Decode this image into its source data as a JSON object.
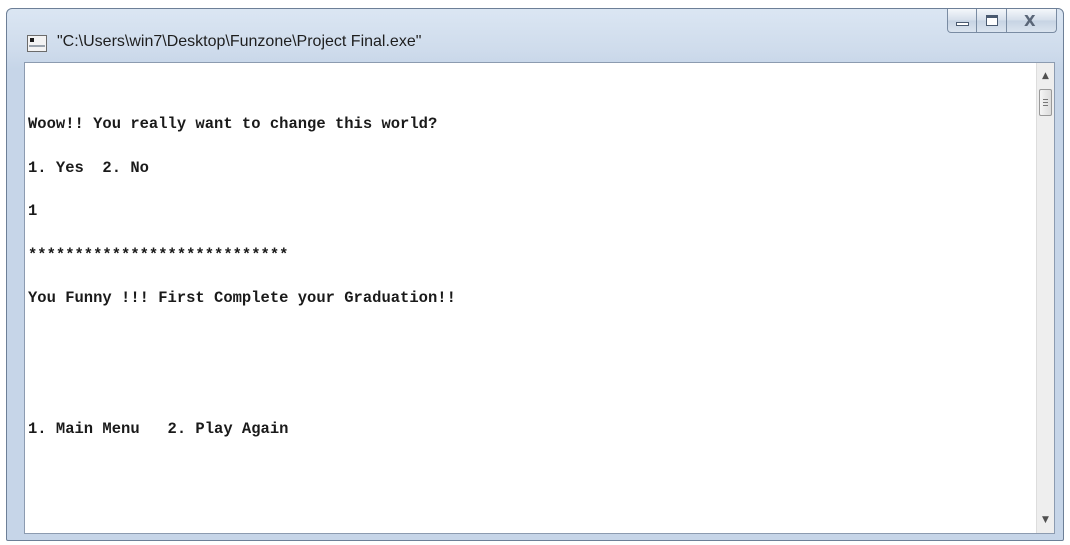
{
  "window": {
    "title": "\"C:\\Users\\win7\\Desktop\\Funzone\\Project Final.exe\"",
    "app_icon": "console-app-icon",
    "controls": {
      "minimize_icon": "minimize-icon",
      "maximize_icon": "maximize-icon",
      "close_glyph": "⌥",
      "close_label": "X"
    }
  },
  "console": {
    "lines": [
      "Woow!! You really want to change this world?",
      "1. Yes  2. No",
      "1",
      "****************************",
      "You Funny !!! First Complete your Graduation!!",
      "",
      "",
      "1. Main Menu   2. Play Again"
    ]
  },
  "scrollbar": {
    "up_arrow": "▲",
    "down_arrow": "▼"
  },
  "colors": {
    "titlebar": "#cfdcec",
    "console_bg": "#ffffff",
    "console_text": "#1a1a1a"
  }
}
